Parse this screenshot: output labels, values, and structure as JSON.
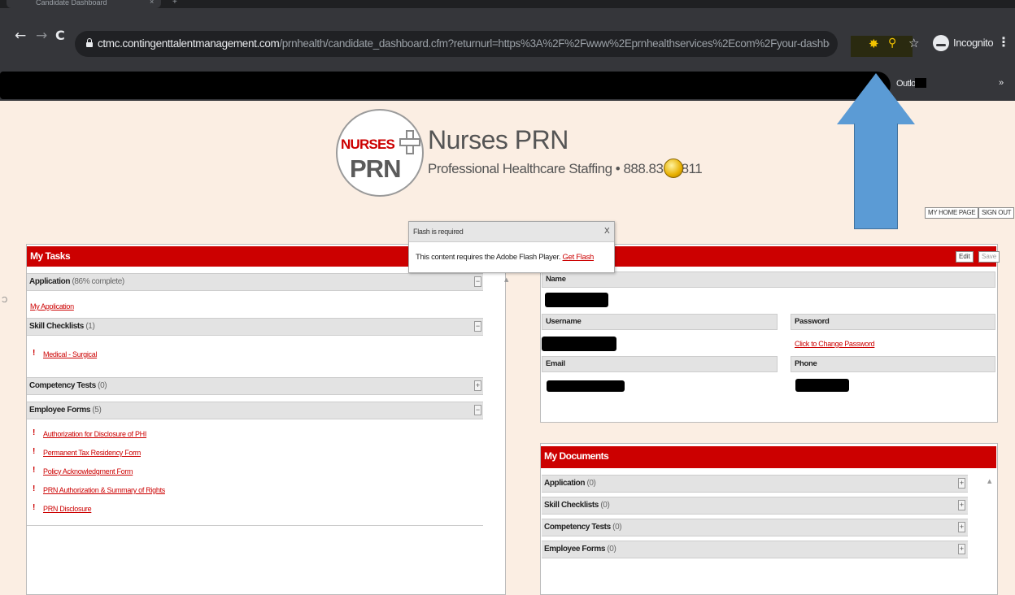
{
  "browser": {
    "tab_title": "Candidate Dashboard",
    "tab_close": "×",
    "new_tab": "+",
    "back": "←",
    "forward": "→",
    "reload": "C",
    "url_host": "ctmc.contingenttalentmanagement.com",
    "url_path": "/prnhealth/candidate_dashboard.cfm?returnurl=https%3A%2F%2Fwww%2Eprnhealthservices%2Ecom%2Fyour-dashboard&mt=",
    "incognito_label": "Incognito",
    "menu": "⋮",
    "bookmark_outlook": "Outlook",
    "bookmark_more": "»"
  },
  "brand": {
    "logo_top": "NURSES",
    "logo_bottom": "PRN",
    "title": "Nurses PRN",
    "tagline": "Professional Healthcare Staffing  •  888.830.8811"
  },
  "top_nav": {
    "home": "MY HOME PAGE",
    "signout": "SIGN OUT"
  },
  "flash": {
    "title": "Flash is required",
    "close": "X",
    "message": "This content requires the Adobe Flash Player.",
    "link": "Get Flash"
  },
  "tasks": {
    "title": "My Tasks",
    "sections": [
      {
        "label": "Application",
        "count": "(86% complete)",
        "toggle": "−"
      },
      {
        "label": "Skill Checklists",
        "count": "(1)",
        "toggle": "−"
      },
      {
        "label": "Competency Tests",
        "count": "(0)",
        "toggle": "+"
      },
      {
        "label": "Employee Forms",
        "count": "(5)",
        "toggle": "−"
      }
    ],
    "application_link": "My Application",
    "skill_items": [
      "Medical - Surgical"
    ],
    "form_items": [
      "Authorization for Disclosure of PHI",
      "Permanent Tax Residency Form",
      "Policy Acknowledgment Form",
      "PRN Authorization & Summary of Rights",
      "PRN Disclosure"
    ],
    "alert_mark": "!"
  },
  "profile": {
    "edit": "Edit",
    "save": "Save",
    "name_label": "Name",
    "username_label": "Username",
    "password_label": "Password",
    "password_link": "Click to Change Password",
    "email_label": "Email",
    "phone_label": "Phone"
  },
  "documents": {
    "title": "My Documents",
    "sections": [
      {
        "label": "Application",
        "count": "(0)",
        "toggle": "+"
      },
      {
        "label": "Skill Checklists",
        "count": "(0)",
        "toggle": "+"
      },
      {
        "label": "Competency Tests",
        "count": "(0)",
        "toggle": "+"
      },
      {
        "label": "Employee Forms",
        "count": "(0)",
        "toggle": "+"
      }
    ]
  },
  "colors": {
    "brand_red": "#cc0000",
    "page_bg": "#fbeee3",
    "annotation_arrow": "#5b9bd5"
  }
}
